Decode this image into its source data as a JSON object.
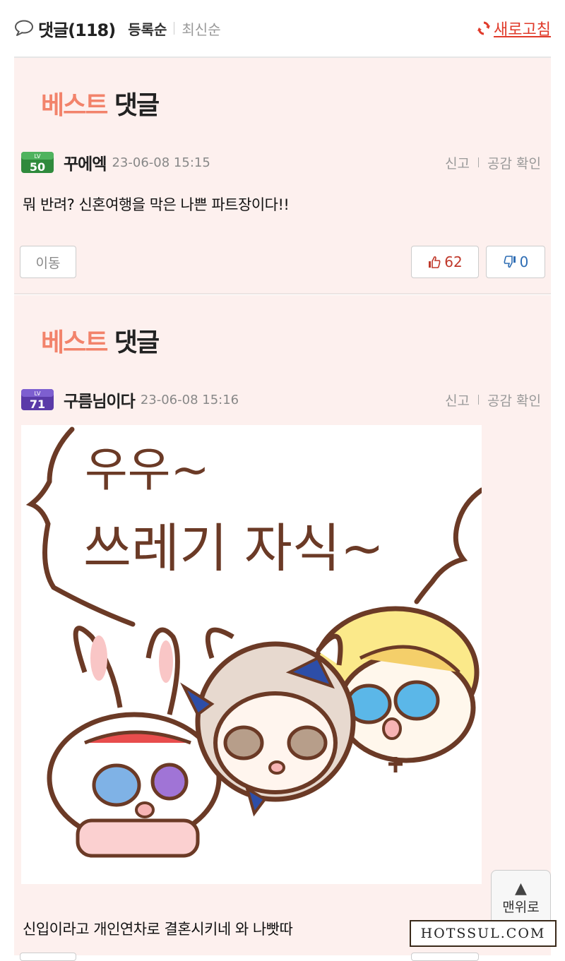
{
  "header": {
    "title": "댓글(118)",
    "sort_active": "등록순",
    "sort_inactive": "최신순",
    "refresh_label": "새로고침"
  },
  "comments": [
    {
      "best_part1": "베스트",
      "best_part2": "댓글",
      "level": "50",
      "level_color": "#2f8a3c",
      "nickname": "꾸에엑",
      "date": "23-06-08 15:15",
      "report": "신고",
      "empathy_check": "공감 확인",
      "text": "뭐 반려? 신혼여행을 막은 나쁜 파트장이다!!",
      "move_label": "이동",
      "likes": "62",
      "dislikes": "0"
    },
    {
      "best_part1": "베스트",
      "best_part2": "댓글",
      "level": "71",
      "level_color": "#5a3aa8",
      "nickname": "구름님이다",
      "date": "23-06-08 15:16",
      "report": "신고",
      "empathy_check": "공감 확인",
      "image_text_line1": "우우~",
      "image_text_line2": "쓰레기 자식~",
      "text": "신입이라고 개인연차로 결혼시키네 와 나빳따"
    }
  ],
  "scroll_top_label": "맨위로",
  "watermark": "HOTSSUL.COM",
  "colors": {
    "accent_red": "#e03a2a",
    "card_bg": "#fdf0ee",
    "best_orange": "#f2836b",
    "like_red": "#c0392b",
    "dislike_blue": "#2e6db4"
  }
}
